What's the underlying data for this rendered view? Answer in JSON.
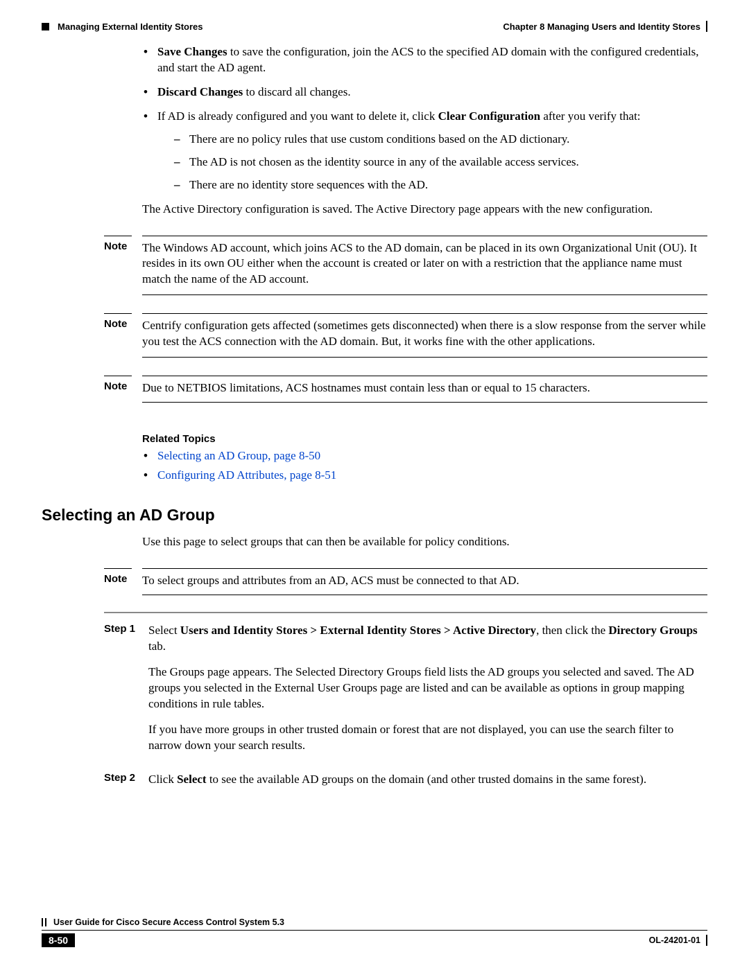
{
  "header": {
    "section": "Managing External Identity Stores",
    "chapter": "Chapter 8      Managing Users and Identity Stores"
  },
  "bullets": {
    "save_bold": "Save Changes",
    "save_rest": " to save the configuration, join the ACS to the specified AD domain with the configured credentials, and start the AD agent.",
    "discard_bold": "Discard Changes",
    "discard_rest": " to discard all changes.",
    "clear_pre": "If AD is already configured and you want to delete it, click ",
    "clear_bold": "Clear Configuration",
    "clear_post": " after you verify that:",
    "sub1": "There are no policy rules that use custom conditions based on the AD dictionary.",
    "sub2": "The AD is not chosen as the identity source in any of the available access services.",
    "sub3": "There are no identity store sequences with the AD."
  },
  "para_after_bullets": "The Active Directory configuration is saved. The Active Directory page appears with the new configuration.",
  "notes": {
    "label": "Note",
    "n1": "The Windows AD account, which joins ACS to the AD domain, can be placed in its own Organizational Unit (OU). It resides in its own OU either when the account is created or later on with a restriction that the appliance name must match the name of the AD account.",
    "n2": "Centrify configuration gets affected (sometimes gets disconnected) when there is a slow response from the server while you test the ACS connection with the AD domain. But, it works fine with the other applications.",
    "n3": "Due to NETBIOS limitations, ACS hostnames must contain less than or equal to 15 characters."
  },
  "related": {
    "heading": "Related Topics",
    "link1": "Selecting an AD Group, page 8-50",
    "link2": "Configuring AD Attributes, page 8-51"
  },
  "section_title": "Selecting an AD Group",
  "section_intro": "Use this page to select groups that can then be available for policy conditions.",
  "note4": "To select groups and attributes from an AD, ACS must be connected to that AD.",
  "steps": {
    "s1_label": "Step 1",
    "s1_pre": "Select ",
    "s1_bold1": "Users and Identity Stores > External Identity Stores > Active Directory",
    "s1_mid": ", then click the ",
    "s1_bold2": "Directory Groups",
    "s1_post": " tab.",
    "s1_p2": "The Groups page appears. The Selected Directory Groups field lists the AD groups you selected and saved. The AD groups you selected in the External User Groups page are listed and can be available as options in group mapping conditions in rule tables.",
    "s1_p3": "If you have more groups in other trusted domain or forest that are not displayed, you can use the search filter to narrow down your search results.",
    "s2_label": "Step 2",
    "s2_pre": "Click ",
    "s2_bold": "Select",
    "s2_post": " to see the available AD groups on the domain (and other trusted domains in the same forest)."
  },
  "footer": {
    "guide": "User Guide for Cisco Secure Access Control System 5.3",
    "page": "8-50",
    "doc": "OL-24201-01"
  }
}
